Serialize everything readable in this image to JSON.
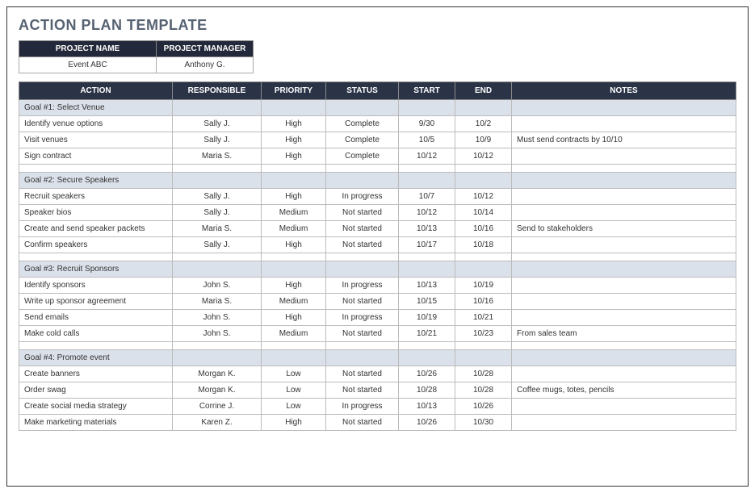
{
  "title": "ACTION PLAN TEMPLATE",
  "meta": {
    "headers": {
      "name": "PROJECT NAME",
      "manager": "PROJECT MANAGER"
    },
    "values": {
      "name": "Event ABC",
      "manager": "Anthony G."
    }
  },
  "columns": {
    "action": "ACTION",
    "responsible": "RESPONSIBLE",
    "priority": "PRIORITY",
    "status": "STATUS",
    "start": "START",
    "end": "END",
    "notes": "NOTES"
  },
  "goals": [
    {
      "label": "Goal #1:  Select Venue",
      "rows": [
        {
          "action": "Identify venue options",
          "responsible": "Sally J.",
          "priority": "High",
          "status": "Complete",
          "start": "9/30",
          "end": "10/2",
          "notes": ""
        },
        {
          "action": "Visit venues",
          "responsible": "Sally J.",
          "priority": "High",
          "status": "Complete",
          "start": "10/5",
          "end": "10/9",
          "notes": "Must send contracts by 10/10"
        },
        {
          "action": "Sign contract",
          "responsible": "Maria S.",
          "priority": "High",
          "status": "Complete",
          "start": "10/12",
          "end": "10/12",
          "notes": ""
        }
      ]
    },
    {
      "label": "Goal #2: Secure Speakers",
      "rows": [
        {
          "action": "Recruit speakers",
          "responsible": "Sally J.",
          "priority": "High",
          "status": "In progress",
          "start": "10/7",
          "end": "10/12",
          "notes": ""
        },
        {
          "action": "Speaker bios",
          "responsible": "Sally J.",
          "priority": "Medium",
          "status": "Not started",
          "start": "10/12",
          "end": "10/14",
          "notes": ""
        },
        {
          "action": "Create and send speaker packets",
          "responsible": "Maria S.",
          "priority": "Medium",
          "status": "Not started",
          "start": "10/13",
          "end": "10/16",
          "notes": "Send to stakeholders"
        },
        {
          "action": "Confirm speakers",
          "responsible": "Sally J.",
          "priority": "High",
          "status": "Not started",
          "start": "10/17",
          "end": "10/18",
          "notes": ""
        }
      ]
    },
    {
      "label": "Goal #3: Recruit Sponsors",
      "rows": [
        {
          "action": "Identify sponsors",
          "responsible": "John S.",
          "priority": "High",
          "status": "In progress",
          "start": "10/13",
          "end": "10/19",
          "notes": ""
        },
        {
          "action": "Write up sponsor agreement",
          "responsible": "Maria S.",
          "priority": "Medium",
          "status": "Not started",
          "start": "10/15",
          "end": "10/16",
          "notes": ""
        },
        {
          "action": "Send emails",
          "responsible": "John S.",
          "priority": "High",
          "status": "In progress",
          "start": "10/19",
          "end": "10/21",
          "notes": ""
        },
        {
          "action": "Make cold calls",
          "responsible": "John S.",
          "priority": "Medium",
          "status": "Not started",
          "start": "10/21",
          "end": "10/23",
          "notes": "From sales team"
        }
      ]
    },
    {
      "label": "Goal #4: Promote event",
      "rows": [
        {
          "action": "Create banners",
          "responsible": "Morgan K.",
          "priority": "Low",
          "status": "Not started",
          "start": "10/26",
          "end": "10/28",
          "notes": ""
        },
        {
          "action": "Order swag",
          "responsible": "Morgan K.",
          "priority": "Low",
          "status": "Not started",
          "start": "10/28",
          "end": "10/28",
          "notes": "Coffee mugs, totes, pencils"
        },
        {
          "action": "Create social media strategy",
          "responsible": "Corrine J.",
          "priority": "Low",
          "status": "In progress",
          "start": "10/13",
          "end": "10/26",
          "notes": ""
        },
        {
          "action": "Make marketing materials",
          "responsible": "Karen Z.",
          "priority": "High",
          "status": "Not started",
          "start": "10/26",
          "end": "10/30",
          "notes": ""
        }
      ]
    }
  ]
}
